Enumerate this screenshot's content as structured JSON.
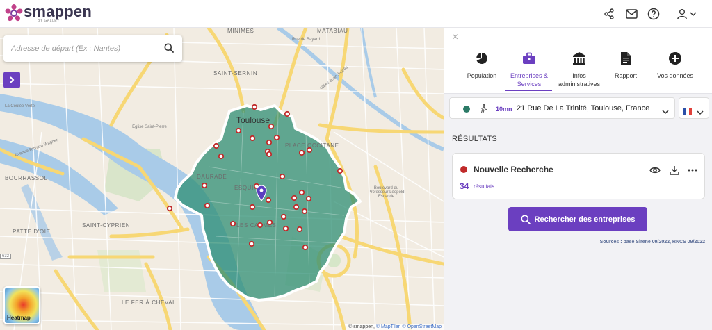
{
  "header": {
    "brand": "smappen",
    "brand_sub": "BY GALLEY",
    "icons": [
      "share-icon",
      "mail-icon",
      "help-icon",
      "user-icon",
      "chevron-down-icon"
    ]
  },
  "map": {
    "search_placeholder": "Adresse de départ (Ex : Nantes)",
    "heatmap_label": "Heatmap",
    "attribution": {
      "prefix": "© smappen, ",
      "maptiler": "© MapTiler",
      "sep": ", ",
      "osm": "© OpenStreetMap"
    },
    "labels": {
      "minimes": "MINIMES",
      "matabiau": "MATABIAU",
      "saint_sernin": "SAINT-SERNIN",
      "toulouse": "Toulouse",
      "place_occitane": "PLACE OCCITANE",
      "daurade": "DAURADE",
      "esquirol": "ESQUIROL",
      "les_carmes": "LES CARMES",
      "bourrassol": "BOURRASSOL",
      "patte_doie": "PATTE D'OIE",
      "saint_cyprien": "SAINT-CYPRIEN",
      "fer_a_cheval": "LE FER À CHEVAL",
      "eglise": "Église Saint-Pierre",
      "route_bayonne": "Rue de Bayard",
      "blvd": "Boulevard du Professeur Léopold Escande",
      "la_couleee": "La Coulée Verte",
      "avenue_wagner": "Avenue Richard Wagner",
      "allees_jean_jaures": "Allées Jean Jaurès",
      "route_632": "632"
    }
  },
  "panel": {
    "close_label": "×",
    "tabs": [
      {
        "label": "Population",
        "icon": "pie-chart-icon",
        "active": false
      },
      {
        "label": "Entreprises & Services",
        "icon": "briefcase-icon",
        "active": true
      },
      {
        "label": "Infos administratives",
        "icon": "institution-icon",
        "active": false
      },
      {
        "label": "Rapport",
        "icon": "document-icon",
        "active": false
      },
      {
        "label": "Vos données",
        "icon": "plus-circle-icon",
        "active": false
      }
    ],
    "location": {
      "color": "#2b7a66",
      "mode_icon": "walking-icon",
      "time": "10mn",
      "address": "21 Rue De La Trinité, Toulouse, France"
    },
    "country_flag": "france-flag-icon",
    "results_title": "RÉSULTATS",
    "result": {
      "color": "#c02a2a",
      "title": "Nouvelle Recherche",
      "count": "34",
      "count_label": "résultats",
      "actions": [
        "eye-icon",
        "download-icon",
        "more-icon"
      ]
    },
    "cta_label": "Rechercher des entreprises",
    "sources": "Sources : base Sirene 09/2022, RNCS 09/2022"
  },
  "colors": {
    "accent": "#6b3fc0",
    "zone_fill": "#2f8f74",
    "marker": "#c02a2a"
  }
}
